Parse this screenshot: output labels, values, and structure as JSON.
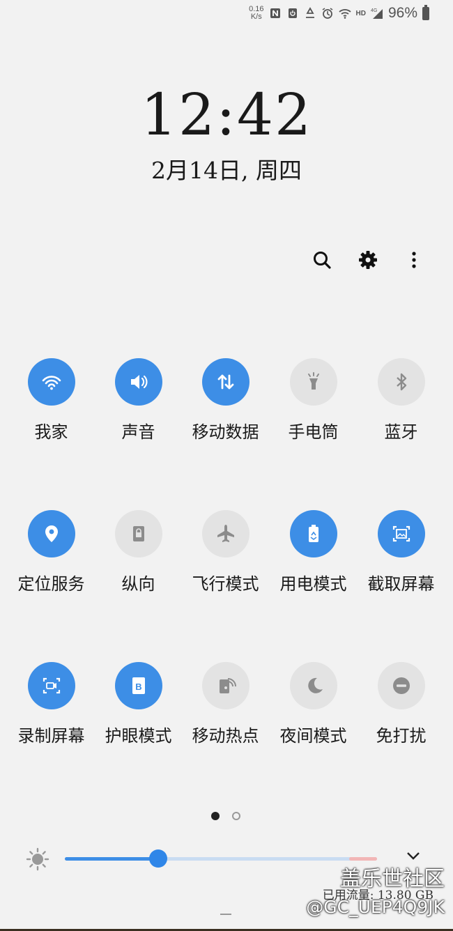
{
  "status_bar": {
    "net_speed_value": "0.16",
    "net_speed_unit": "K/s",
    "hd": "HD",
    "network": "4G",
    "battery": "96%"
  },
  "lock": {
    "time": "12:42",
    "date": "2月14日, 周四"
  },
  "actions": [
    "search-icon",
    "gear-icon",
    "more-icon"
  ],
  "tiles": [
    {
      "label": "我家",
      "icon": "wifi-icon",
      "on": true
    },
    {
      "label": "声音",
      "icon": "volume-icon",
      "on": true
    },
    {
      "label": "移动数据",
      "icon": "data-arrows-icon",
      "on": true
    },
    {
      "label": "手电筒",
      "icon": "flashlight-icon",
      "on": false
    },
    {
      "label": "蓝牙",
      "icon": "bluetooth-icon",
      "on": false
    },
    {
      "label": "定位服务",
      "icon": "location-icon",
      "on": true
    },
    {
      "label": "纵向",
      "icon": "portrait-lock-icon",
      "on": false
    },
    {
      "label": "飞行模式",
      "icon": "airplane-icon",
      "on": false
    },
    {
      "label": "用电模式",
      "icon": "battery-mode-icon",
      "on": true
    },
    {
      "label": "截取屏幕",
      "icon": "screenshot-icon",
      "on": true
    },
    {
      "label": "录制屏幕",
      "icon": "screen-record-icon",
      "on": true
    },
    {
      "label": "护眼模式",
      "icon": "eye-comfort-icon",
      "on": true
    },
    {
      "label": "移动热点",
      "icon": "hotspot-icon",
      "on": false
    },
    {
      "label": "夜间模式",
      "icon": "moon-icon",
      "on": false
    },
    {
      "label": "免打扰",
      "icon": "do-not-disturb-icon",
      "on": false
    }
  ],
  "pager": {
    "pages": 2,
    "current": 1
  },
  "brightness": {
    "level": 0.3
  },
  "watermark": {
    "site": "盖乐世社区",
    "usage": "已用流量: 13.80 GB",
    "user": "@GC_UEP4Q9JK"
  },
  "colors": {
    "accent": "#3d8ee6",
    "off": "#e3e3e3",
    "background": "#f2f2f2"
  }
}
